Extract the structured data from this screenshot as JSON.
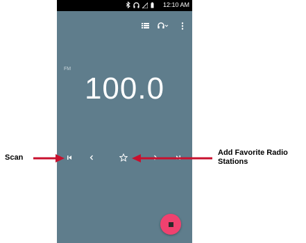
{
  "status_bar": {
    "time": "12:10 AM",
    "icons": [
      "bluetooth-icon",
      "headphones-icon",
      "signal-icon",
      "battery-icon"
    ]
  },
  "app_bar": {
    "icons": [
      "station-list-icon",
      "headset-output-icon",
      "more-options-icon"
    ]
  },
  "radio": {
    "band": "FM",
    "frequency": "100.0"
  },
  "controls": [
    "scan-icon",
    "previous-icon",
    "favorite-star-icon",
    "next-icon",
    "seek-next-icon"
  ],
  "annotations": {
    "scan": "Scan",
    "favorite": "Add Favorite Radio Stations"
  },
  "colors": {
    "screen_bg": "#5f7d8c",
    "status_bar": "#000000",
    "fab": "#f0416f",
    "arrow": "#c8102e"
  }
}
